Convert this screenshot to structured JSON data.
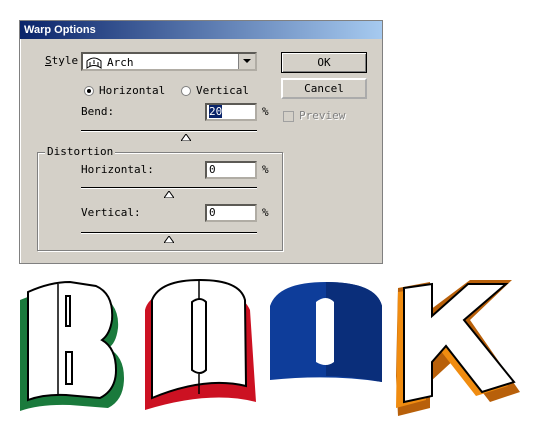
{
  "window": {
    "title": "Warp Options"
  },
  "style": {
    "label": "Style",
    "value": "Arch",
    "icon": "arch-icon"
  },
  "orientation": {
    "horizontal_label": "Horizontal",
    "vertical_label": "Vertical",
    "selected": "Horizontal"
  },
  "bend": {
    "label": "Bend:",
    "value": "20",
    "unit": "%",
    "slider_percent": 20
  },
  "distortion": {
    "group_label": "Distortion",
    "horizontal": {
      "label": "Horizontal:",
      "value": "0",
      "unit": "%",
      "slider_percent": 0
    },
    "vertical": {
      "label": "Vertical:",
      "value": "0",
      "unit": "%",
      "slider_percent": 0
    }
  },
  "buttons": {
    "ok": "OK",
    "cancel": "Cancel"
  },
  "preview": {
    "label": "Preview",
    "checked": false,
    "enabled": false
  },
  "wordart": {
    "letters": [
      "B",
      "O",
      "O",
      "K"
    ],
    "colors": [
      "#1a7a3c",
      "#cc1122",
      "#0e3d9a",
      "#f08c10"
    ]
  }
}
